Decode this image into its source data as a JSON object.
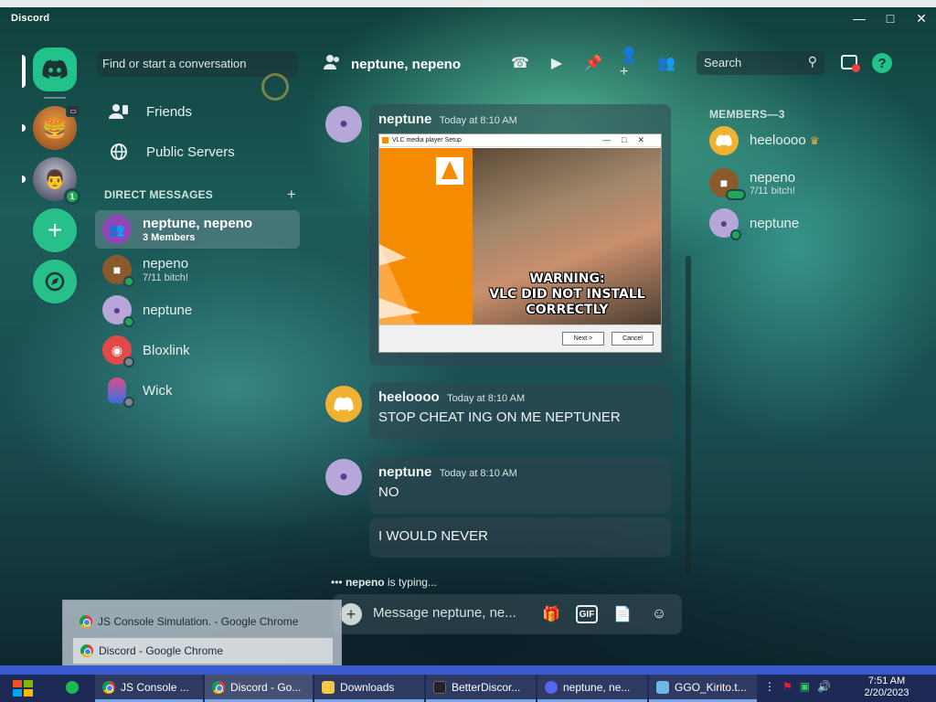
{
  "window": {
    "title": "Discord",
    "controls": [
      "minimize",
      "maximize",
      "close"
    ]
  },
  "sidebar": {
    "search_placeholder": "Find or start a conversation",
    "nav": [
      {
        "label": "Friends",
        "icon": "friends-icon"
      },
      {
        "label": "Public Servers",
        "icon": "globe-icon"
      }
    ],
    "dm_header": "DIRECT MESSAGES",
    "dms": [
      {
        "name": "neptune, nepeno",
        "sub": "3 Members",
        "active": true,
        "status": "group"
      },
      {
        "name": "nepeno",
        "sub": "7/11 bitch!",
        "status": "online"
      },
      {
        "name": "neptune",
        "sub": "",
        "status": "online"
      },
      {
        "name": "Bloxlink",
        "sub": "",
        "status": "offline"
      },
      {
        "name": "Wick",
        "sub": "",
        "status": "offline"
      }
    ]
  },
  "guilds": {
    "pres_badge": "1"
  },
  "header": {
    "channel": "neptune, nepeno",
    "search_placeholder": "Search",
    "icons": [
      "call-icon",
      "video-icon",
      "pin-icon",
      "add-member-icon",
      "members-icon"
    ]
  },
  "messages": [
    {
      "author": "neptune",
      "timestamp": "Today at 8:10 AM",
      "attachment": {
        "window_title": "VLC media player Setup",
        "warning_line1": "WARNING:",
        "warning_line2": "VLC DID NOT INSTALL CORRECTLY",
        "next_btn": "Next >",
        "cancel_btn": "Cancel"
      }
    },
    {
      "author": "heeloooo",
      "timestamp": "Today at 8:10 AM",
      "content": "STOP CHEAT ING ON ME NEPTUNER"
    },
    {
      "author": "neptune",
      "timestamp": "Today at 8:10 AM",
      "content": "NO",
      "followup": "I WOULD NEVER"
    }
  ],
  "typing": {
    "user": "nepeno",
    "suffix": " is typing..."
  },
  "composer": {
    "placeholder": "Message neptune, ne..."
  },
  "members": {
    "title": "MEMBERS—3",
    "list": [
      {
        "name": "heeloooo",
        "owner": true,
        "sub": ""
      },
      {
        "name": "nepeno",
        "owner": false,
        "sub": "7/11 bitch!"
      },
      {
        "name": "neptune",
        "owner": false,
        "sub": ""
      }
    ]
  },
  "popup": {
    "rows": [
      "JS Console Simulation. - Google Chrome",
      "Discord - Google Chrome"
    ]
  },
  "taskbar": {
    "items": [
      {
        "label": "",
        "icon": "spotify-icon"
      },
      {
        "label": "JS Console ...",
        "icon": "chrome-icon"
      },
      {
        "label": "Discord - Go...",
        "icon": "chrome-icon"
      },
      {
        "label": "Downloads",
        "icon": "folder-icon"
      },
      {
        "label": "BetterDiscor...",
        "icon": "terminal-icon"
      },
      {
        "label": "neptune, ne...",
        "icon": "discord-icon"
      },
      {
        "label": "GGO_Kirito.t...",
        "icon": "paint-icon"
      }
    ],
    "time": "7:51 AM",
    "date": "2/20/2023"
  },
  "colors": {
    "accent": "#23c28b",
    "online": "#23a55a",
    "offline": "#80848e"
  }
}
